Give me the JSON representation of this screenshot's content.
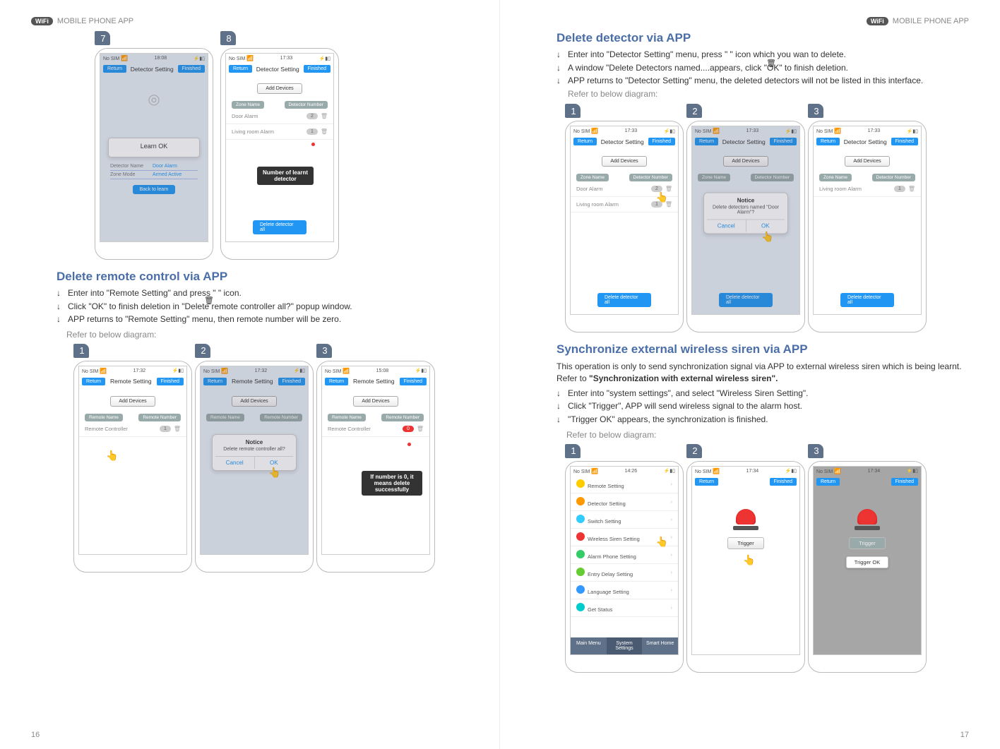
{
  "header": {
    "wifi_chip": "WiFi",
    "section": "MOBILE PHONE APP"
  },
  "pageNumbers": {
    "left": "16",
    "right": "17"
  },
  "left": {
    "phone7": {
      "step": "7",
      "status_left": "No SIM",
      "status_time": "18:08",
      "nav_return": "Return",
      "nav_title": "Detector Setting",
      "nav_finished": "Finished",
      "popup_title": "Learn OK",
      "det_name_lbl": "Detector Name",
      "det_name_val": "Door Alarm",
      "zone_lbl": "Zone Mode",
      "zone_val": "Armed Active",
      "back_btn": "Back to learn"
    },
    "phone8": {
      "step": "8",
      "status_left": "No SIM",
      "status_time": "17:33",
      "nav_return": "Return",
      "nav_title": "Detector Setting",
      "nav_finished": "Finished",
      "add": "Add Devices",
      "col1": "Zone Name",
      "col2": "Detector Number",
      "row1_name": "Door Alarm",
      "row1_count": "2",
      "row2_name": "Living room Alarm",
      "row2_count": "1",
      "callout": "Number of learnt detector",
      "del_all": "Delete detector all"
    },
    "h_delete_remote": "Delete remote control via APP",
    "bullets_remote": {
      "b1": "Enter into \"Remote Setting\" and press \"       \" icon.",
      "b2": "Click \"OK\" to finish deletion in \"Delete remote controller all?\" popup window.",
      "b3": "APP returns to \"Remote Setting\" menu, then remote number will be zero."
    },
    "refer": "Refer to below diagram:",
    "remote1": {
      "step": "1",
      "status_left": "No SIM",
      "status_time": "17:32",
      "nav_return": "Return",
      "nav_title": "Remote Setting",
      "nav_finished": "Finished",
      "add": "Add Devices",
      "col1": "Remote Name",
      "col2": "Remote Number",
      "row1_name": "Remote Controller",
      "row1_count": "1"
    },
    "remote2": {
      "step": "2",
      "status_left": "No SIM",
      "status_time": "17:32",
      "nav_return": "Return",
      "nav_title": "Remote Setting",
      "nav_finished": "Finished",
      "add": "Add Devices",
      "col1": "Remote Name",
      "col2": "Remote Number",
      "popup_title": "Notice",
      "popup_msg": "Delete remote controller all?",
      "popup_cancel": "Cancel",
      "popup_ok": "OK"
    },
    "remote3": {
      "step": "3",
      "status_left": "No SIM",
      "status_time": "15:08",
      "nav_return": "Return",
      "nav_title": "Remote Setting",
      "nav_finished": "Finished",
      "add": "Add Devices",
      "col1": "Remote Name",
      "col2": "Remote Number",
      "row1_name": "Remote Controller",
      "row1_count": "0",
      "callout": "If number is 0, it means delete successfully"
    }
  },
  "right": {
    "h_delete_detector": "Delete detector via APP",
    "bullets_detector": {
      "b1": "Enter into \"Detector Setting\" menu, press \"       \" icon which you wan to delete.",
      "b2": "A window \"Delete Detectors named....appears, click \"OK\" to finish deletion.",
      "b3_a": "APP returns to \"Detector Setting\" menu, the deleted detectors will not be listed in this interface.",
      "b3_b": "Refer to below diagram:"
    },
    "det1": {
      "step": "1",
      "status_left": "No SIM",
      "status_time": "17:33",
      "nav_return": "Return",
      "nav_title": "Detector Setting",
      "nav_finished": "Finished",
      "add": "Add Devices",
      "col1": "Zone Name",
      "col2": "Detector Number",
      "row1_name": "Door Alarm",
      "row1_count": "2",
      "row2_name": "Living room Alarm",
      "row2_count": "1",
      "del_all": "Delete detector all"
    },
    "det2": {
      "step": "2",
      "status_left": "No SIM",
      "status_time": "17:33",
      "nav_return": "Return",
      "nav_title": "Detector Setting",
      "nav_finished": "Finished",
      "add": "Add Devices",
      "col1": "Zone Name",
      "col2": "Detector Number",
      "popup_title": "Notice",
      "popup_msg": "Delete detectors named \"Door Alarm\"?",
      "popup_cancel": "Cancel",
      "popup_ok": "OK",
      "del_all": "Delete detector all"
    },
    "det3": {
      "step": "3",
      "status_left": "No SIM",
      "status_time": "17:33",
      "nav_return": "Return",
      "nav_title": "Detector Setting",
      "nav_finished": "Finished",
      "add": "Add Devices",
      "col1": "Zone Name",
      "col2": "Detector Number",
      "row1_name": "Living room Alarm",
      "row1_count": "1",
      "del_all": "Delete detector all"
    },
    "h_sync": "Synchronize external wireless siren via APP",
    "sync_intro_a": "This operation is only to send synchronization signal via APP to external wireless siren which is being learnt. Refer to ",
    "sync_intro_b": "\"Synchronization with external wireless siren\".",
    "bullets_sync": {
      "b1": "Enter into \"system settings\", and select \"Wireless Siren Setting\".",
      "b2": "Click \"Trigger\", APP will send wireless signal to the alarm host.",
      "b3": "\"Trigger OK\" appears, the synchronization is finished."
    },
    "refer": "Refer to below diagram:",
    "sync1": {
      "step": "1",
      "status_left": "No SIM",
      "status_time": "14:26",
      "items": {
        "remote": "Remote Setting",
        "detector": "Detector Setting",
        "switch": "Switch Setting",
        "siren": "Wireless Siren Setting",
        "phone": "Alarm Phone Setting",
        "delay": "Entry Delay Setting",
        "lang": "Language Setting",
        "status": "Get Status"
      },
      "tabs": {
        "main": "Main Menu",
        "sys": "System Settings",
        "smart": "Smart Home"
      }
    },
    "sync2": {
      "step": "2",
      "status_left": "No SIM",
      "status_time": "17:34",
      "nav_return": "Return",
      "nav_finished": "Finished",
      "trigger": "Trigger"
    },
    "sync3": {
      "step": "3",
      "status_left": "No SIM",
      "status_time": "17:34",
      "nav_return": "Return",
      "nav_finished": "Finished",
      "trigger": "Trigger",
      "ok": "Trigger OK"
    }
  }
}
